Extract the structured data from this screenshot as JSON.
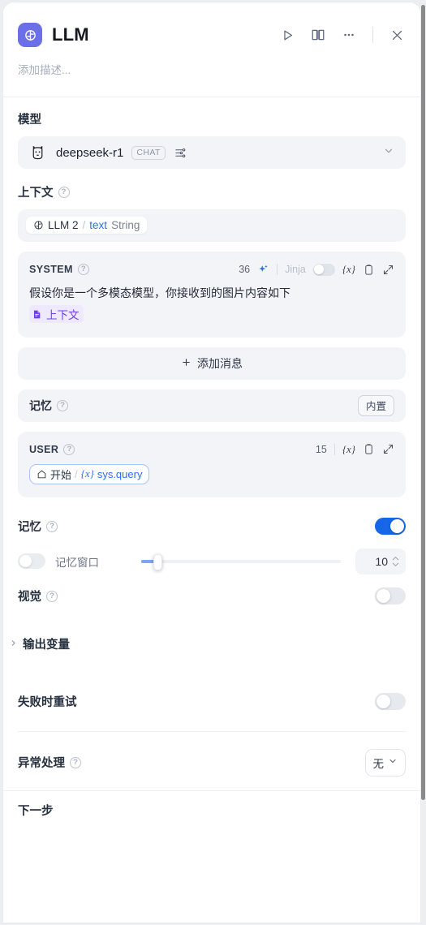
{
  "header": {
    "logo_icon": "llm-node-icon",
    "title": "LLM",
    "actions": [
      {
        "name": "run-button",
        "icon": "play-icon"
      },
      {
        "name": "docs-button",
        "icon": "book-icon"
      },
      {
        "name": "more-button",
        "icon": "ellipsis-icon"
      },
      {
        "name": "close-button",
        "icon": "close-icon"
      }
    ],
    "description_placeholder": "添加描述..."
  },
  "model": {
    "section_label": "模型",
    "avatar_icon": "llama-icon",
    "name": "deepseek-r1",
    "badge": "CHAT",
    "settings_icon": "sliders-icon",
    "chevron_icon": "chevron-down-icon"
  },
  "context": {
    "section_label": "上下文",
    "help_icon": "question-icon",
    "chip": {
      "node_icon": "llm-circle-icon",
      "node": "LLM 2",
      "separator": "/",
      "variable": "text",
      "type": "String"
    }
  },
  "messages": [
    {
      "role": "SYSTEM",
      "help_icon": "question-icon",
      "tokens": "36",
      "sparkle_icon": "sparkle-icon",
      "jinja_label": "Jinja",
      "jinja_enabled": false,
      "variable_icon": "{x}",
      "copy_icon": "clipboard-icon",
      "expand_icon": "expand-icon",
      "text": "假设你是一个多模态模型，你接收到的图片内容如下",
      "tag": {
        "icon": "document-icon",
        "label": "上下文"
      }
    },
    {
      "role": "USER",
      "help_icon": "question-icon",
      "tokens": "15",
      "variable_icon": "{x}",
      "copy_icon": "clipboard-icon",
      "expand_icon": "expand-icon",
      "pill": {
        "node_icon": "home-icon",
        "node": "开始",
        "separator": "/",
        "var_icon": "{x}",
        "variable": "sys.query"
      }
    }
  ],
  "add_message": {
    "icon": "plus-icon",
    "label": "添加消息"
  },
  "memory_builtin": {
    "label": "记忆",
    "help_icon": "question-icon",
    "badge": "内置"
  },
  "memory": {
    "label": "记忆",
    "help_icon": "question-icon",
    "enabled": true,
    "window": {
      "enabled": false,
      "label": "记忆窗口",
      "value": "10",
      "slider_percent": 8
    }
  },
  "vision": {
    "label": "视觉",
    "help_icon": "question-icon",
    "enabled": false
  },
  "output_variables": {
    "caret_icon": "chevron-right-icon",
    "label": "输出变量"
  },
  "retry_on_failure": {
    "label": "失败时重试",
    "enabled": false
  },
  "error_handling": {
    "label": "异常处理",
    "help_icon": "question-icon",
    "value": "无",
    "chevron_icon": "chevron-down-icon"
  },
  "next_step": {
    "label": "下一步"
  }
}
